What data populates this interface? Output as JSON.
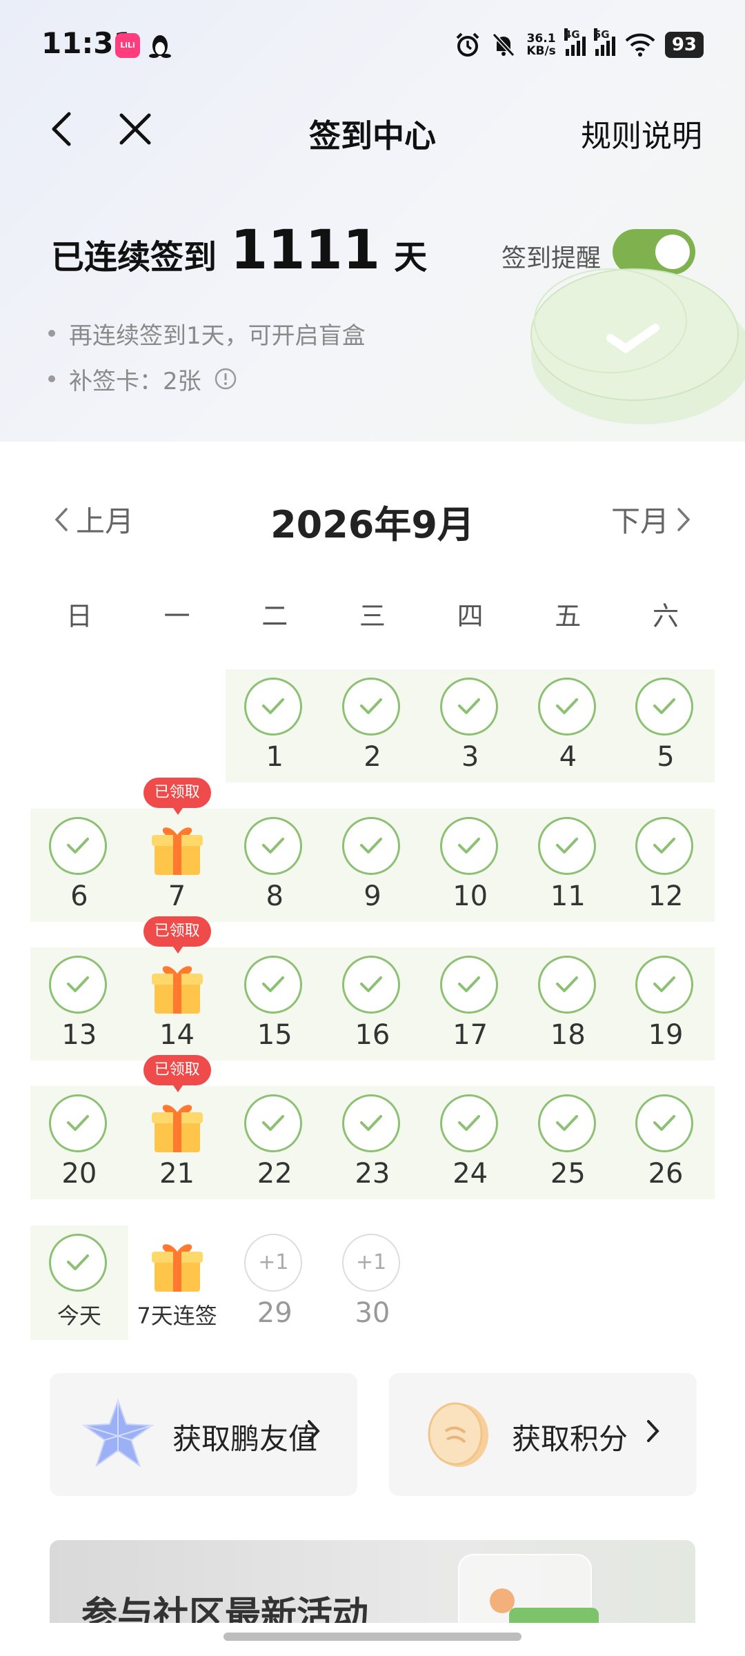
{
  "status_bar": {
    "time": "11:31",
    "app_icon_text": "LiLi",
    "net_speed_value": "36.1",
    "net_speed_unit": "KB/s",
    "signal1": "4G",
    "signal2": "5G",
    "battery": "93"
  },
  "nav": {
    "title": "签到中心",
    "rules": "规则说明"
  },
  "streak": {
    "prefix": "已连续签到",
    "days": "1111",
    "suffix": "天",
    "reminder_label": "签到提醒",
    "reminder_on": true
  },
  "bullets": {
    "line1": "再连续签到1天，可开启盲盒",
    "line2": "补签卡：2张"
  },
  "calendar": {
    "prev": "上月",
    "next": "下月",
    "title": "2026年9月",
    "weekdays": [
      "日",
      "一",
      "二",
      "三",
      "四",
      "五",
      "六"
    ],
    "claimed_badge": "已领取",
    "today_label": "今天",
    "streak_gift_label": "7天连签",
    "future_bonus": "+1",
    "days": [
      "1",
      "2",
      "3",
      "4",
      "5",
      "6",
      "7",
      "8",
      "9",
      "10",
      "11",
      "12",
      "13",
      "14",
      "15",
      "16",
      "17",
      "18",
      "19",
      "20",
      "21",
      "22",
      "23",
      "24",
      "25",
      "26",
      "29",
      "30"
    ]
  },
  "cards": {
    "friend_value": "获取鹏友值",
    "points": "获取积分"
  },
  "banner": {
    "title": "参与社区最新活动"
  }
}
